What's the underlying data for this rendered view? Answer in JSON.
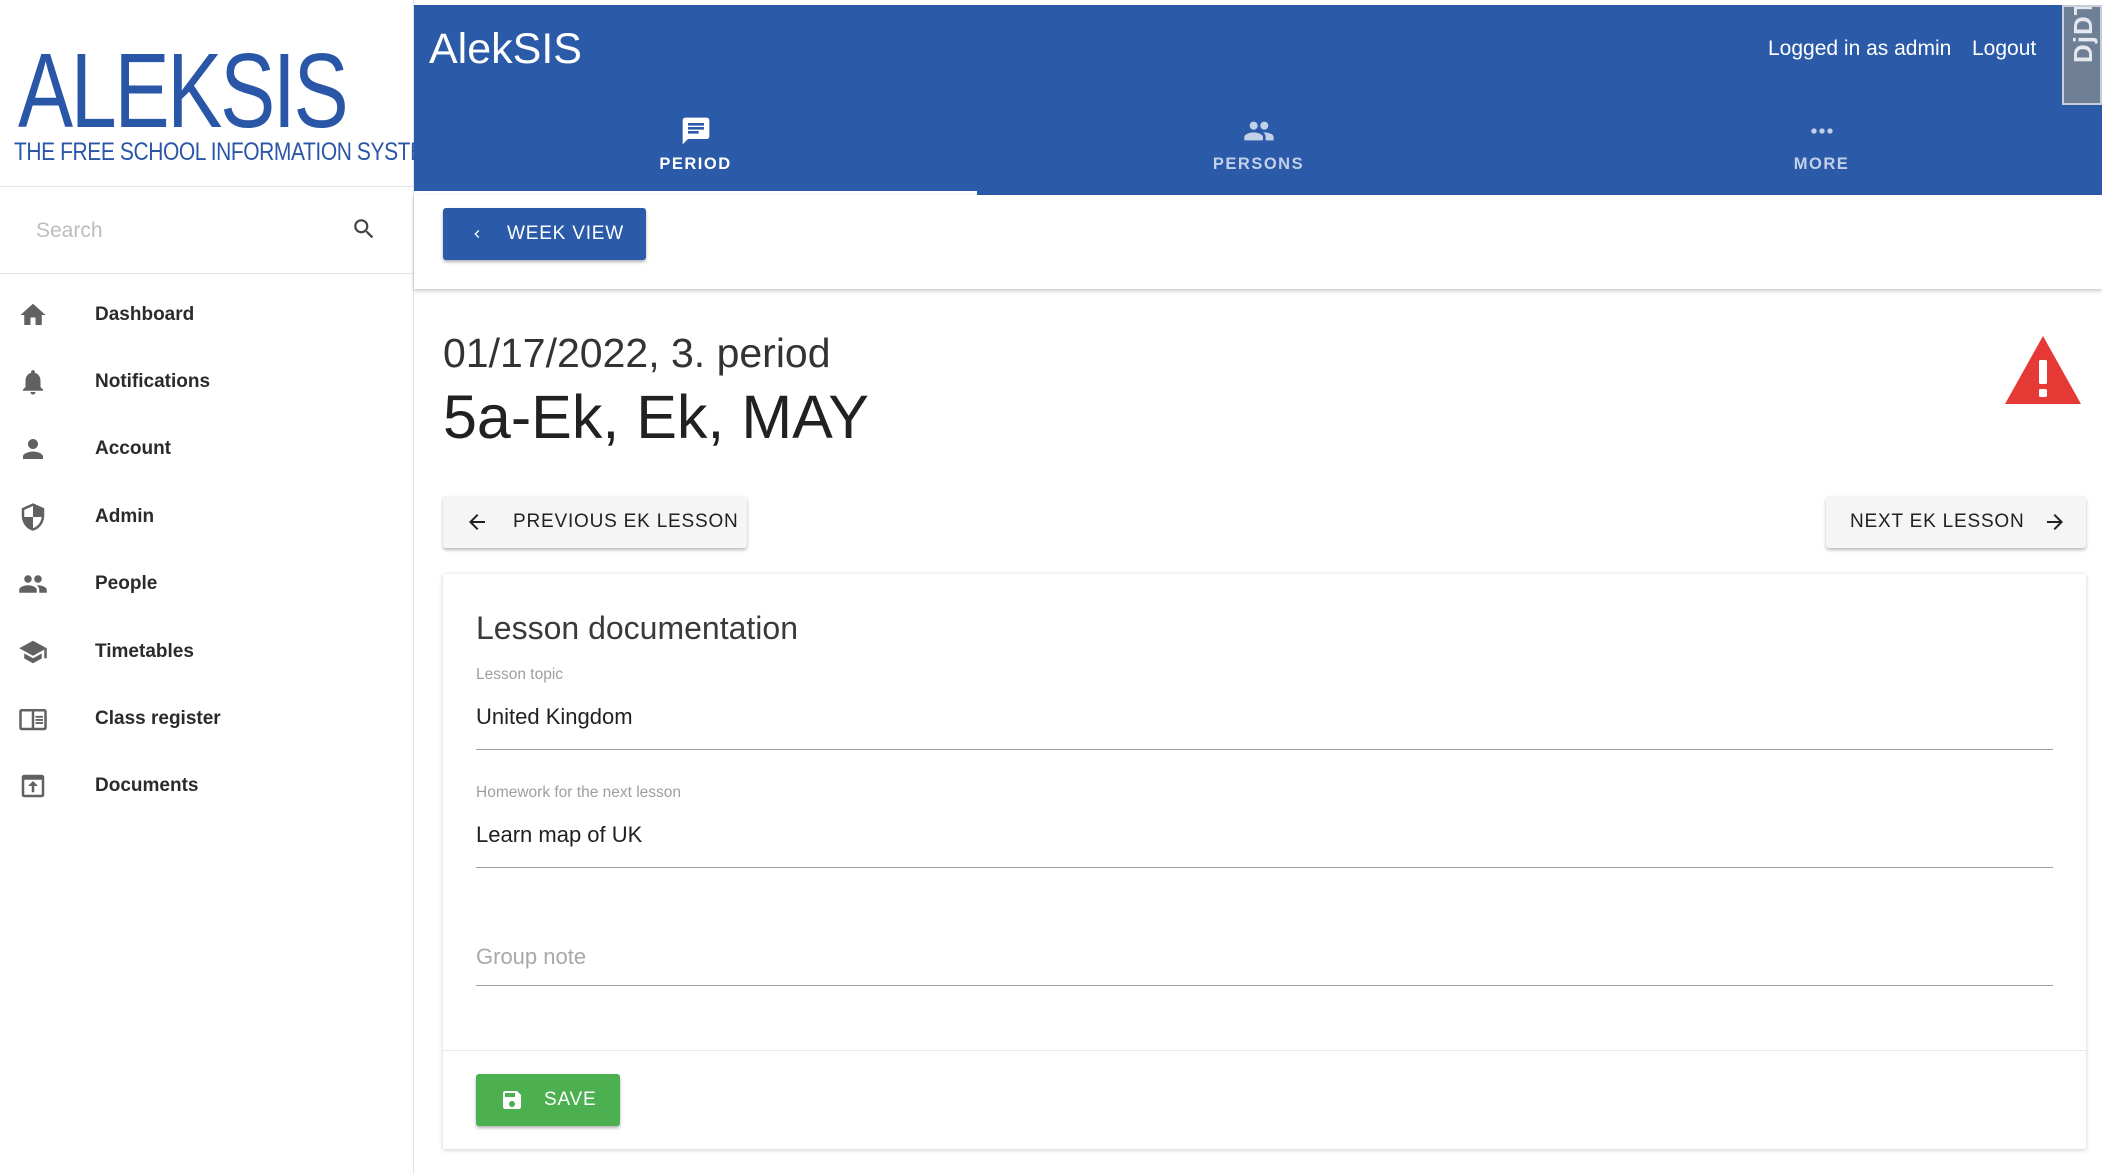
{
  "brand": {
    "logo_word": "ALEKSIS",
    "logo_tagline": "THE FREE SCHOOL INFORMATION SYSTEM",
    "app_title": "AlekSIS",
    "primary_color": "#2a5aa8"
  },
  "search": {
    "placeholder": "Search",
    "value": ""
  },
  "sidebar": {
    "items": [
      {
        "label": "Dashboard",
        "icon": "home-icon"
      },
      {
        "label": "Notifications",
        "icon": "bell-icon"
      },
      {
        "label": "Account",
        "icon": "person-icon"
      },
      {
        "label": "Admin",
        "icon": "shield-icon"
      },
      {
        "label": "People",
        "icon": "people-icon"
      },
      {
        "label": "Timetables",
        "icon": "school-icon"
      },
      {
        "label": "Class register",
        "icon": "class-register-icon"
      },
      {
        "label": "Documents",
        "icon": "documents-icon"
      }
    ]
  },
  "header": {
    "user_text": "Logged in as admin",
    "logout_label": "Logout",
    "debug_label": "DjDT"
  },
  "tabs": [
    {
      "label": "PERIOD",
      "icon": "message-icon",
      "active": true
    },
    {
      "label": "PERSONS",
      "icon": "people-icon",
      "active": false
    },
    {
      "label": "MORE",
      "icon": "more-horiz-icon",
      "active": false
    }
  ],
  "toolbar": {
    "week_view_label": "WEEK VIEW"
  },
  "lesson": {
    "date_period": "01/17/2022, 3. period",
    "title": "5a-Ek, Ek, MAY",
    "warning_color": "#e53935"
  },
  "navigation": {
    "previous_label": "PREVIOUS EK LESSON",
    "next_label": "NEXT EK LESSON"
  },
  "documentation": {
    "title": "Lesson documentation",
    "topic_label": "Lesson topic",
    "topic_value": "United Kingdom",
    "homework_label": "Homework for the next lesson",
    "homework_value": "Learn map of UK",
    "group_note_placeholder": "Group note",
    "group_note_value": "",
    "save_label": "SAVE",
    "save_color": "#4caf50"
  }
}
